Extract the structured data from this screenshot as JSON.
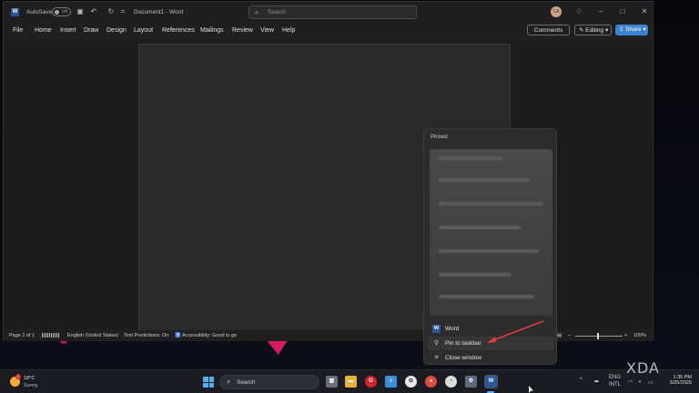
{
  "titlebar": {
    "autosave_label": "AutoSave",
    "autosave_state": "Off",
    "document_title": "Document1 - Word",
    "search_placeholder": "Search",
    "avatar_initials": "CA"
  },
  "menu": {
    "items": [
      "File",
      "Home",
      "Insert",
      "Draw",
      "Design",
      "Layout",
      "References",
      "Mailings",
      "Review",
      "View",
      "Help"
    ],
    "comments_label": "Comments",
    "editing_label": "Editing",
    "share_label": "Share"
  },
  "statusbar": {
    "page": "Page 1 of 1",
    "language": "English (United States)",
    "predictions": "Text Predictions: On",
    "accessibility": "Accessibility: Good to go",
    "zoom": "100%"
  },
  "jumplist": {
    "header": "Pinned",
    "items": [
      {
        "label": "Word",
        "icon": "word-icon"
      },
      {
        "label": "Pin to taskbar",
        "icon": "pin-icon"
      },
      {
        "label": "Close window",
        "icon": "close-icon"
      }
    ]
  },
  "taskbar": {
    "weather_temp": "18°C",
    "weather_cond": "Sunny",
    "weather_badge": "1",
    "search_placeholder": "Search",
    "tray_lang1": "ENG",
    "tray_lang2": "INTL",
    "time": "1:35 PM",
    "date": "3/25/2025"
  },
  "watermark": "XDA",
  "colors": {
    "accent": "#3b82d0",
    "word_blue": "#2b579a",
    "arrow_red": "#e23c3c"
  }
}
